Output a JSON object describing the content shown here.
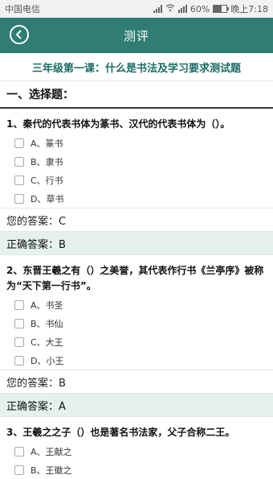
{
  "status": {
    "carrier": "中国电信",
    "battery": "60%",
    "battery_level": 0.6,
    "time": "晚上7:18"
  },
  "header": {
    "title": "测评",
    "back_icon": "back-icon"
  },
  "quiz": {
    "title": "三年级第一课：什么是书法及学习要求测试题",
    "section": "一、选择题："
  },
  "questions": [
    {
      "text": "1、秦代的代表书体为篆书、汉代的代表书体为（）。",
      "options": [
        "A、篆书",
        "B、隶书",
        "C、行书",
        "D、草书"
      ],
      "your_answer": "您的答案：C",
      "correct_answer": "正确答案：B"
    },
    {
      "text": "2、东晋王羲之有（）之美誉，其代表作行书《兰亭序》被称为“天下第一行书”。",
      "options": [
        "A、书圣",
        "B、书仙",
        "C、大王",
        "D、小王"
      ],
      "your_answer": "您的答案：B",
      "correct_answer": "正确答案：A"
    },
    {
      "text": "3、王羲之之子（）也是著名书法家，父子合称二王。",
      "options": [
        "A、王献之",
        "B、王徽之"
      ]
    }
  ],
  "colors": {
    "header": "#2f7d73",
    "accent_text": "#1a6d66",
    "correct_bg": "#e4f1ef"
  }
}
